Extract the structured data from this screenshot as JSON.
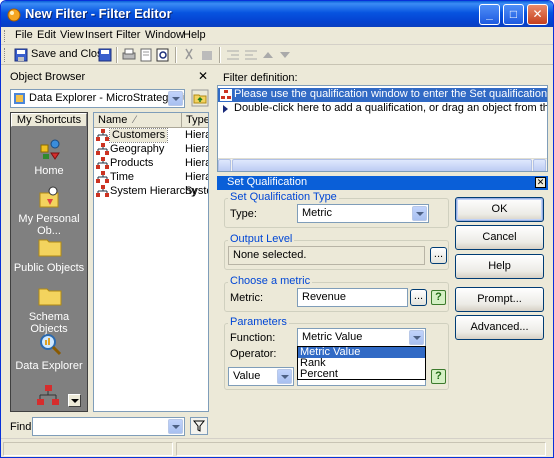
{
  "window": {
    "title": "New Filter - Filter Editor"
  },
  "menu": [
    "File",
    "Edit",
    "View",
    "Insert",
    "Filter",
    "Window",
    "Help"
  ],
  "toolbar": {
    "save_close_label": "Save and Close"
  },
  "object_browser": {
    "title": "Object Browser",
    "project": "Data Explorer - MicroStrategy Tutorial",
    "shortcuts_title": "My Shortcuts",
    "shortcuts": [
      "Home",
      "My Personal Ob...",
      "Public Objects",
      "Schema Objects",
      "Data Explorer"
    ],
    "columns": {
      "name": "Name",
      "type": "Type"
    },
    "items": [
      {
        "name": "Customers",
        "type": "Hierar"
      },
      {
        "name": "Geography",
        "type": "Hierar"
      },
      {
        "name": "Products",
        "type": "Hierar"
      },
      {
        "name": "Time",
        "type": "Hierar"
      },
      {
        "name": "System Hierarchy",
        "type": "Syste"
      }
    ],
    "find_label": "Find:"
  },
  "filter_definition": {
    "title": "Filter definition:",
    "line1": "Please use the qualification window to enter the Set qualification.",
    "line2": "Double-click here to add a qualification, or drag an object from the object browser"
  },
  "set_qualification": {
    "title": "Set Qualification",
    "type_group": "Set Qualification Type",
    "type_label": "Type:",
    "type_value": "Metric",
    "output_group": "Output Level",
    "output_value": "None selected.",
    "metric_group": "Choose a metric",
    "metric_label": "Metric:",
    "metric_value": "Revenue",
    "params_group": "Parameters",
    "function_label": "Function:",
    "function_value": "Metric Value",
    "operator_label": "Operator:",
    "value_select": "Value",
    "function_options": [
      "Metric Value",
      "Rank",
      "Percent"
    ],
    "ellipsis": "..."
  },
  "buttons": {
    "ok": "OK",
    "cancel": "Cancel",
    "help": "Help",
    "prompt": "Prompt...",
    "advanced": "Advanced..."
  },
  "colors": {
    "title_bar": "#0754e0",
    "selection": "#316ac5",
    "group_title": "#0046d5",
    "shortcut_bg": "#808080"
  }
}
